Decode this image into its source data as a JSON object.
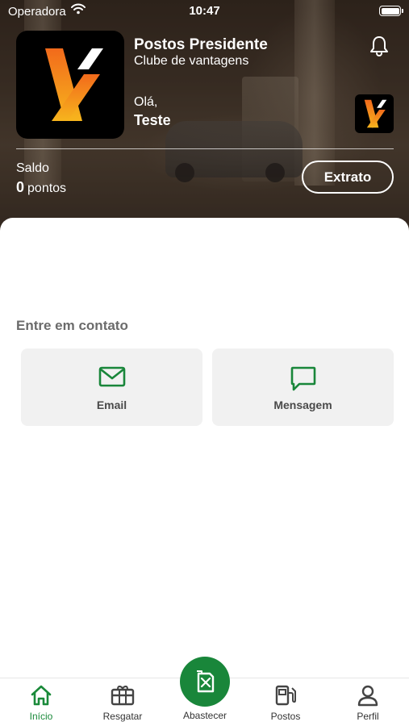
{
  "status_bar": {
    "carrier": "Operadora",
    "time": "10:47"
  },
  "header": {
    "store_name": "Postos Presidente",
    "subtitle": "Clube de vantagens",
    "greeting": "Olá,",
    "user_name": "Teste",
    "balance_label": "Saldo",
    "balance_value": "0",
    "balance_unit": "pontos",
    "statement_button": "Extrato"
  },
  "contact": {
    "title": "Entre em contato",
    "options": [
      {
        "label": "Email",
        "icon": "mail-icon"
      },
      {
        "label": "Mensagem",
        "icon": "chat-bubble-icon"
      }
    ]
  },
  "tabbar": {
    "items": [
      {
        "label": "Início",
        "icon": "home-icon",
        "active": true
      },
      {
        "label": "Resgatar",
        "icon": "gift-icon"
      },
      {
        "label": "Abastecer",
        "icon": "fuel-can-icon"
      },
      {
        "label": "Postos",
        "icon": "fuel-pump-icon"
      },
      {
        "label": "Perfil",
        "icon": "user-icon"
      }
    ]
  },
  "colors": {
    "accent_green": "#19863a",
    "brand_orange": "#f08a1c",
    "brand_yellow": "#f7c21b"
  }
}
